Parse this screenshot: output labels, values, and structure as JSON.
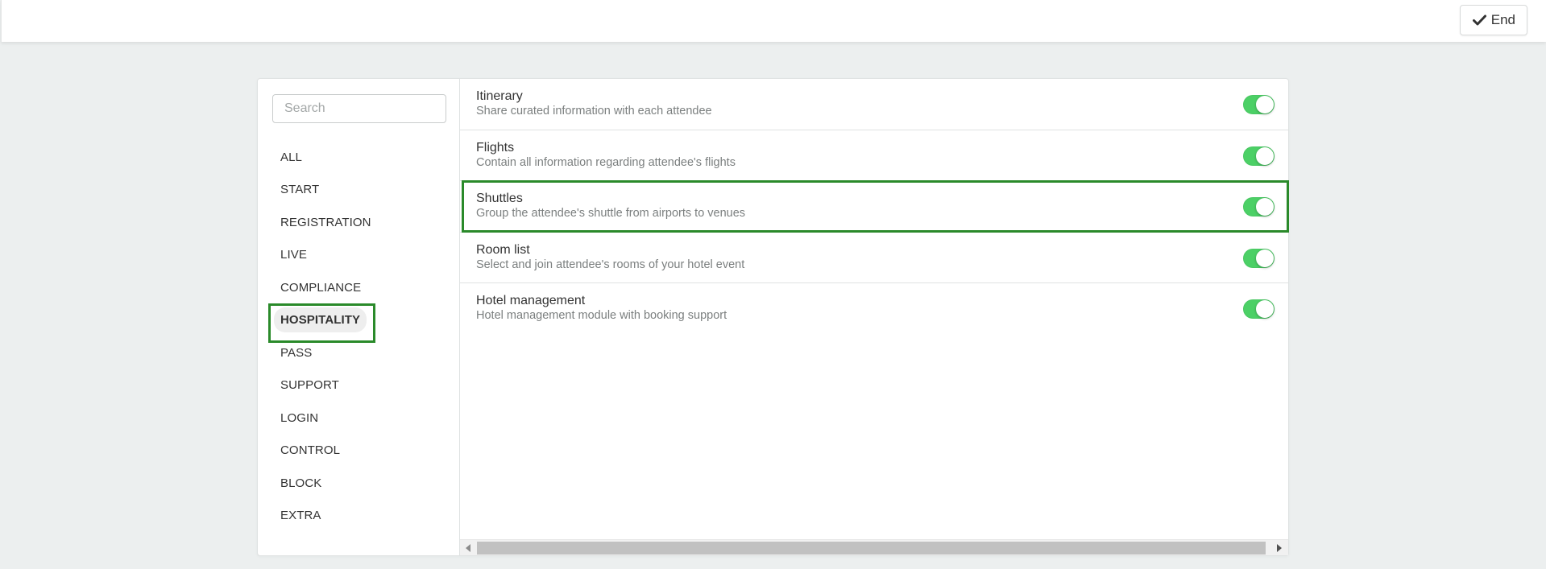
{
  "header": {
    "end_button": {
      "label": "End",
      "icon": "checkmark-icon"
    }
  },
  "sidebar": {
    "search": {
      "placeholder": "Search",
      "value": ""
    },
    "items": [
      {
        "label": "ALL",
        "active": false
      },
      {
        "label": "START",
        "active": false
      },
      {
        "label": "REGISTRATION",
        "active": false
      },
      {
        "label": "LIVE",
        "active": false
      },
      {
        "label": "COMPLIANCE",
        "active": false
      },
      {
        "label": "HOSPITALITY",
        "active": true
      },
      {
        "label": "PASS",
        "active": false
      },
      {
        "label": "SUPPORT",
        "active": false
      },
      {
        "label": "LOGIN",
        "active": false
      },
      {
        "label": "CONTROL",
        "active": false
      },
      {
        "label": "BLOCK",
        "active": false
      },
      {
        "label": "EXTRA",
        "active": false
      }
    ]
  },
  "modules": [
    {
      "title": "Itinerary",
      "description": "Share curated information with each attendee",
      "enabled": true,
      "highlighted": false
    },
    {
      "title": "Flights",
      "description": "Contain all information regarding attendee's flights",
      "enabled": true,
      "highlighted": false
    },
    {
      "title": "Shuttles",
      "description": "Group the attendee's shuttle from airports to venues",
      "enabled": true,
      "highlighted": true
    },
    {
      "title": "Room list",
      "description": "Select and join attendee's rooms of your hotel event",
      "enabled": true,
      "highlighted": false
    },
    {
      "title": "Hotel management",
      "description": "Hotel management module with booking support",
      "enabled": true,
      "highlighted": false
    }
  ],
  "colors": {
    "toggle_on": "#4cd066",
    "highlight_border": "#2a8a2a",
    "page_background": "#ecefef"
  }
}
